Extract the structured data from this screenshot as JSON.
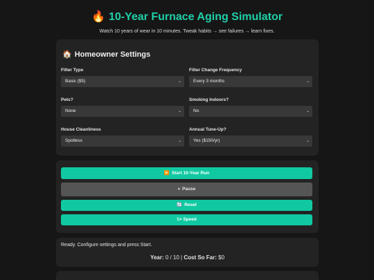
{
  "header": {
    "title_emoji": "🔥",
    "title": "10-Year Furnace Aging Simulator",
    "subtitle": "Watch 10 years of wear in 10 minutes. Tweak habits → see failures → learn fixes."
  },
  "settings": {
    "heading_emoji": "🏠",
    "heading": "Homeowner Settings",
    "fields": {
      "filter_type": {
        "label": "Filter Type",
        "value": "Basic ($5)"
      },
      "filter_frequency": {
        "label": "Filter Change Frequency",
        "value": "Every 3 months"
      },
      "pets": {
        "label": "Pets?",
        "value": "None"
      },
      "smoking": {
        "label": "Smoking Indoors?",
        "value": "No"
      },
      "cleanliness": {
        "label": "House Cleanliness",
        "value": "Spotless"
      },
      "tuneup": {
        "label": "Annual Tune-Up?",
        "value": "Yes ($150/yr)"
      }
    }
  },
  "controls": {
    "start": {
      "icon": "▶️",
      "label": "Start 10-Year Run"
    },
    "pause": {
      "icon": "⏸",
      "label": "Pause"
    },
    "reset": {
      "icon": "🔄",
      "label": "Reset"
    },
    "speed": {
      "label": "1× Speed"
    }
  },
  "status": {
    "message": "Ready. Configure settings and press Start.",
    "year_label": "Year:",
    "year_value": "0 / 10",
    "separator": "|",
    "cost_label": "Cost So Far:",
    "cost_value": "$0"
  },
  "colors": {
    "accent": "#10c9a2",
    "title": "#1fd0a8",
    "background": "#161616",
    "card": "#232323"
  },
  "icons": {
    "title": "fire-icon",
    "settings": "house-icon",
    "start": "play-icon",
    "pause": "pause-icon",
    "reset": "refresh-icon",
    "select": "chevron-down-icon"
  }
}
